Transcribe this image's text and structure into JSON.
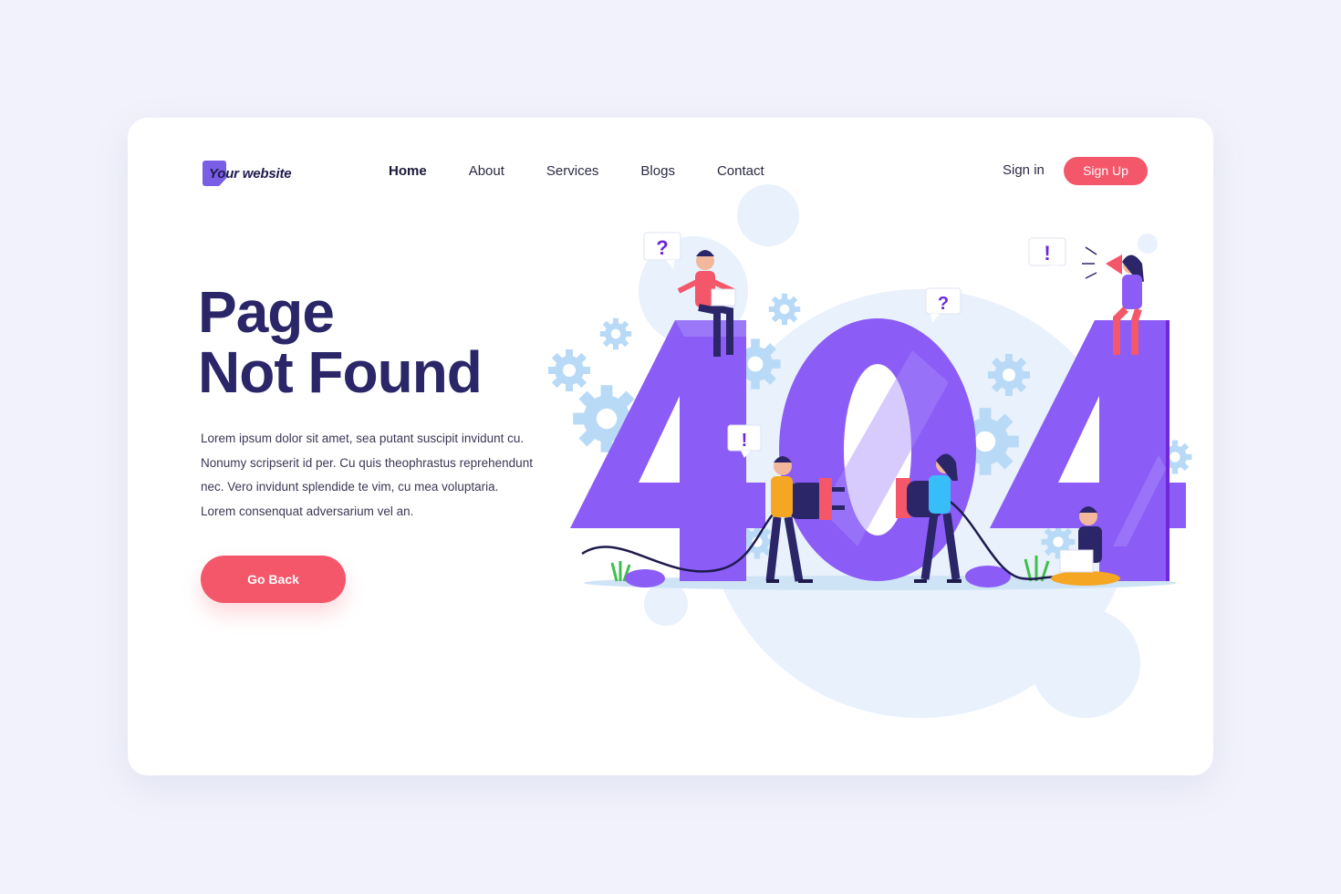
{
  "brand": {
    "name": "Your website"
  },
  "nav": {
    "items": [
      {
        "label": "Home",
        "active": true
      },
      {
        "label": "About",
        "active": false
      },
      {
        "label": "Services",
        "active": false
      },
      {
        "label": "Blogs",
        "active": false
      },
      {
        "label": "Contact",
        "active": false
      }
    ]
  },
  "auth": {
    "signin_label": "Sign in",
    "signup_label": "Sign Up"
  },
  "hero": {
    "title_line1": "Page",
    "title_line2": "Not Found",
    "body": "Lorem ipsum dolor sit amet, sea putant suscipit invidunt cu. Nonumy scripserit id per. Cu quis theophrastus reprehendunt nec. Vero invidunt splendide te vim, cu mea voluptaria. Lorem consenquat adversarium vel an.",
    "button_label": "Go Back"
  },
  "illustration": {
    "code": "404",
    "bubbles": [
      "?",
      "!",
      "?",
      "!"
    ]
  },
  "colors": {
    "background": "#f1f2fb",
    "title": "#2a2668",
    "accent": "#f4566a",
    "brand": "#7b5ee6",
    "digits": "#8b5cf6"
  }
}
